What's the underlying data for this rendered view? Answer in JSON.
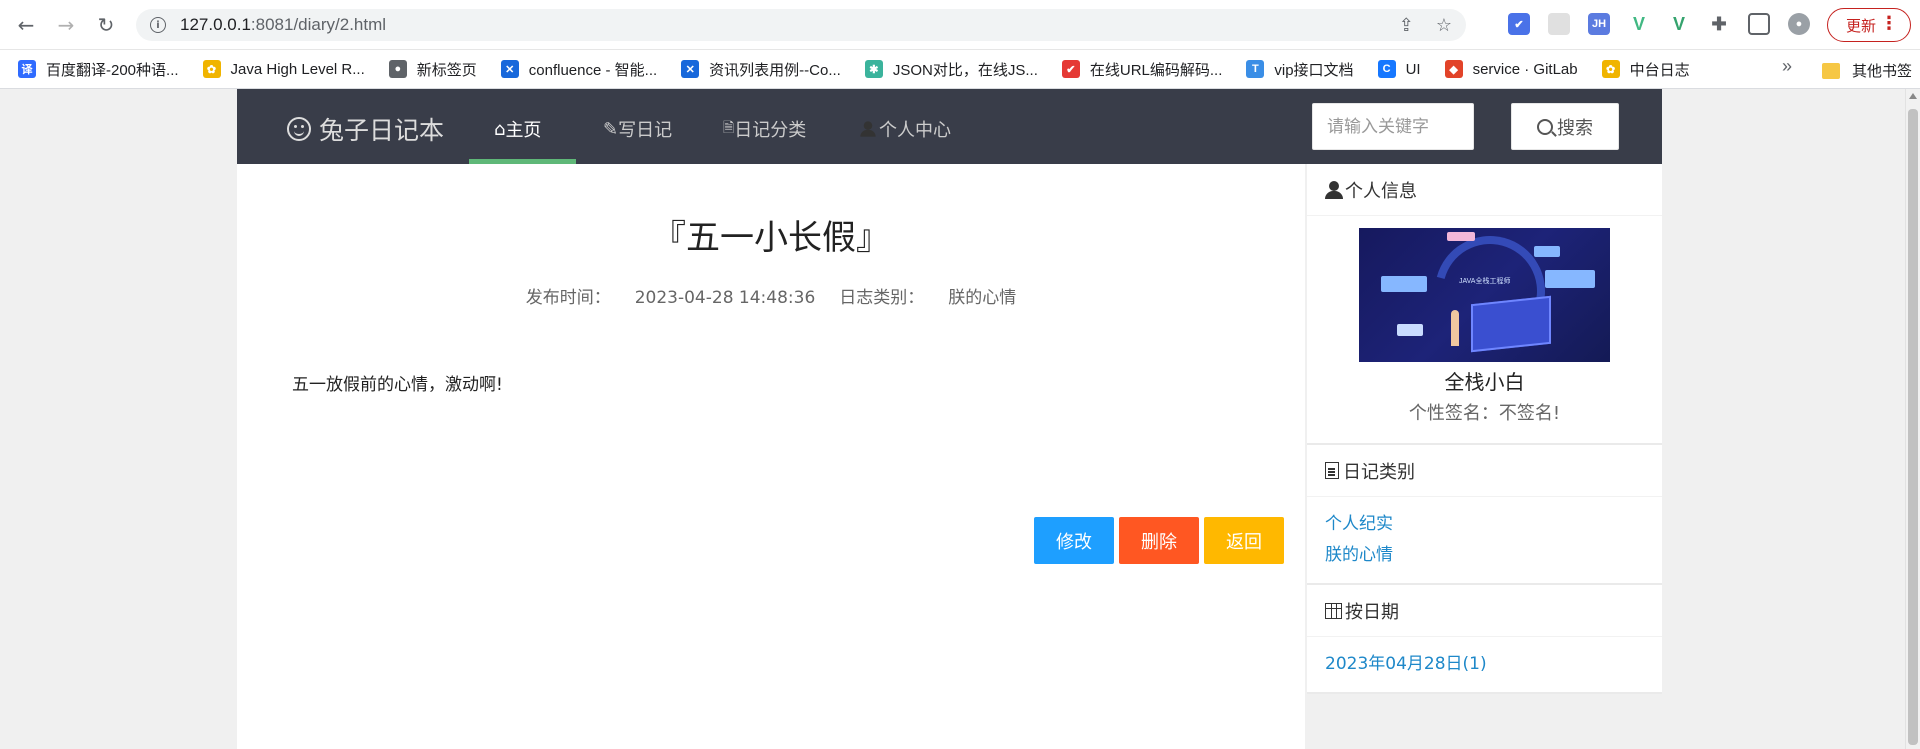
{
  "browser": {
    "url_host": "127.0.0.1",
    "url_rest": ":8081/diary/2.html",
    "update_label": "更新",
    "bookmarks": [
      {
        "label": "百度翻译-200种语...",
        "icon": "translate-icon",
        "color": "#2f6bff",
        "glyph": "译"
      },
      {
        "label": "Java High Level R...",
        "icon": "elastic-icon",
        "color": "#f0b400",
        "glyph": "✿"
      },
      {
        "label": "新标签页",
        "icon": "dot-icon",
        "color": "#5f6368",
        "glyph": "●"
      },
      {
        "label": "confluence - 智能...",
        "icon": "confluence-icon",
        "color": "#1868db",
        "glyph": "✕"
      },
      {
        "label": "资讯列表用例--Co...",
        "icon": "confluence-icon",
        "color": "#1868db",
        "glyph": "✕"
      },
      {
        "label": "JSON对比，在线JS...",
        "icon": "gear-icon",
        "color": "#3bb39c",
        "glyph": "✱"
      },
      {
        "label": "在线URL编码解码...",
        "icon": "check-icon",
        "color": "#e53935",
        "glyph": "✔"
      },
      {
        "label": "vip接口文档",
        "icon": "t-icon",
        "color": "#3a8ee6",
        "glyph": "T"
      },
      {
        "label": "UI",
        "icon": "c-icon",
        "color": "#1677ff",
        "glyph": "C"
      },
      {
        "label": "service · GitLab",
        "icon": "gitlab-icon",
        "color": "#e24329",
        "glyph": "◆"
      },
      {
        "label": "中台日志",
        "icon": "elastic-icon",
        "color": "#f0b400",
        "glyph": "✿"
      }
    ],
    "bookmarks_more": "»",
    "other_bookmarks": "其他书签"
  },
  "navbar": {
    "brand": "兔子日记本",
    "items": [
      {
        "label": "主页",
        "icon": "home-icon",
        "glyph": "⌂"
      },
      {
        "label": "写日记",
        "icon": "pencil-icon",
        "glyph": "✎"
      },
      {
        "label": "日记分类",
        "icon": "document-icon",
        "glyph": "🗎"
      },
      {
        "label": "个人中心",
        "icon": "user-icon",
        "glyph": "👤"
      }
    ],
    "search_placeholder": "请输入关键字",
    "search_label": "搜索"
  },
  "diary": {
    "title": "『五一小长假』",
    "published_label": "发布时间：",
    "published_value": "2023-04-28 14:48:36",
    "category_label": "日志类别：",
    "category_value": "朕的心情",
    "content": "五一放假前的心情，激动啊!",
    "edit_label": "修改",
    "delete_label": "删除",
    "back_label": "返回"
  },
  "sidebar": {
    "profile_title": "个人信息",
    "avatar_caption": "JAVA全栈工程师",
    "user_name": "全栈小白",
    "signature": "个性签名：不签名!",
    "categories_title": "日记类别",
    "categories": [
      "个人纪实",
      "朕的心情"
    ],
    "dates_title": "按日期",
    "dates": [
      "2023年04月28日(1)"
    ]
  },
  "colors": {
    "navbar_bg": "#393d49",
    "active_underline": "#5fb878",
    "edit": "#1e9fff",
    "delete": "#ff5722",
    "back": "#ffb800",
    "link": "#1e88c9"
  }
}
